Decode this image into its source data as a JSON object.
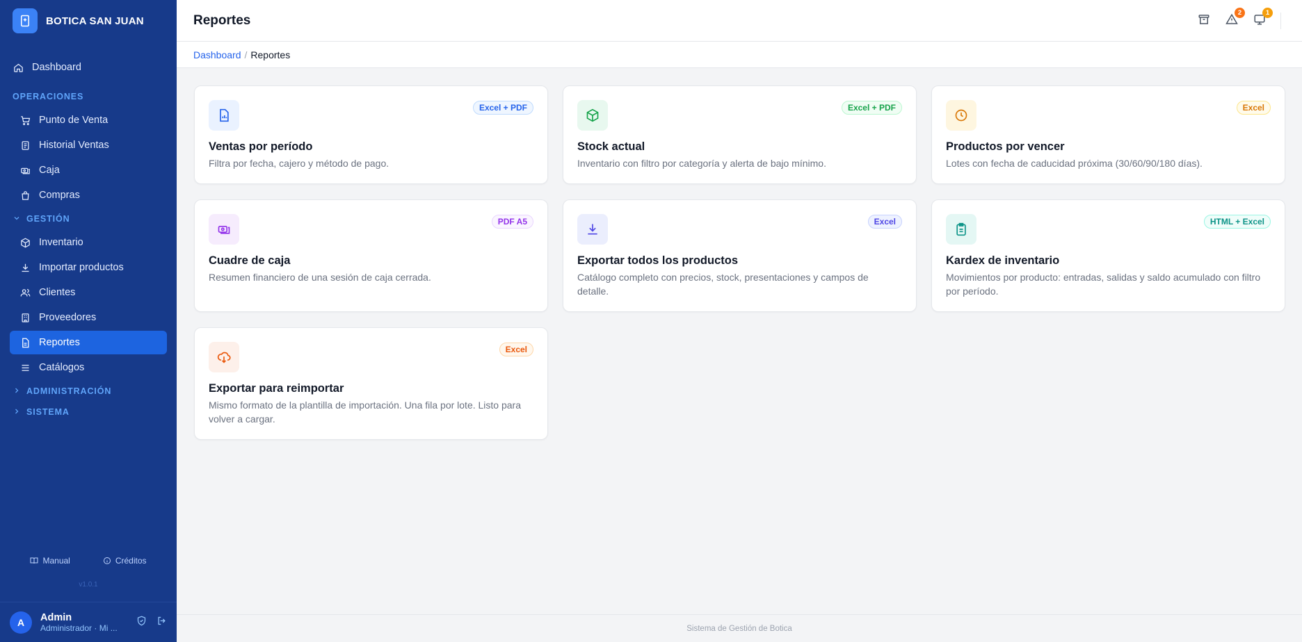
{
  "app": {
    "name": "BOTICA SAN JUAN"
  },
  "sidebar": {
    "dashboard": "Dashboard",
    "operaciones_label": "OPERACIONES",
    "operaciones": [
      "Punto de Venta",
      "Historial Ventas",
      "Caja",
      "Compras"
    ],
    "gestion_label": "GESTIÓN",
    "gestion": [
      "Inventario",
      "Importar productos",
      "Clientes",
      "Proveedores",
      "Reportes",
      "Catálogos"
    ],
    "administracion_label": "ADMINISTRACIÓN",
    "sistema_label": "SISTEMA",
    "manual": "Manual",
    "creditos": "Créditos",
    "version": "v1.0.1"
  },
  "user": {
    "initial": "A",
    "name": "Admin",
    "role": "Administrador · Mi ..."
  },
  "header": {
    "title": "Reportes",
    "alerts_count": "2",
    "messages_count": "1"
  },
  "breadcrumb": {
    "home": "Dashboard",
    "sep": "/",
    "current": "Reportes"
  },
  "cards": [
    {
      "title": "Ventas por período",
      "desc": "Filtra por fecha, cajero y método de pago.",
      "badge": "Excel + PDF",
      "icon": "report-chart-icon"
    },
    {
      "title": "Stock actual",
      "desc": "Inventario con filtro por categoría y alerta de bajo mínimo.",
      "badge": "Excel + PDF",
      "icon": "box-icon"
    },
    {
      "title": "Productos por vencer",
      "desc": "Lotes con fecha de caducidad próxima (30/60/90/180 días).",
      "badge": "Excel",
      "icon": "clock-icon"
    },
    {
      "title": "Cuadre de caja",
      "desc": "Resumen financiero de una sesión de caja cerrada.",
      "badge": "PDF A5",
      "icon": "cash-icon"
    },
    {
      "title": "Exportar todos los productos",
      "desc": "Catálogo completo con precios, stock, presentaciones y campos de detalle.",
      "badge": "Excel",
      "icon": "download-icon"
    },
    {
      "title": "Kardex de inventario",
      "desc": "Movimientos por producto: entradas, salidas y saldo acumulado con filtro por período.",
      "badge": "HTML + Excel",
      "icon": "clipboard-icon"
    },
    {
      "title": "Exportar para reimportar",
      "desc": "Mismo formato de la plantilla de importación. Una fila por lote. Listo para volver a cargar.",
      "badge": "Excel",
      "icon": "cloud-download-icon"
    }
  ],
  "footer": {
    "text": "Sistema de Gestión de Botica"
  },
  "colors": {
    "sidebar": "#173a8a",
    "active": "#1d64e0",
    "accent": "#2563eb",
    "alert_badge": "#f97316",
    "message_badge": "#f59e0b"
  }
}
